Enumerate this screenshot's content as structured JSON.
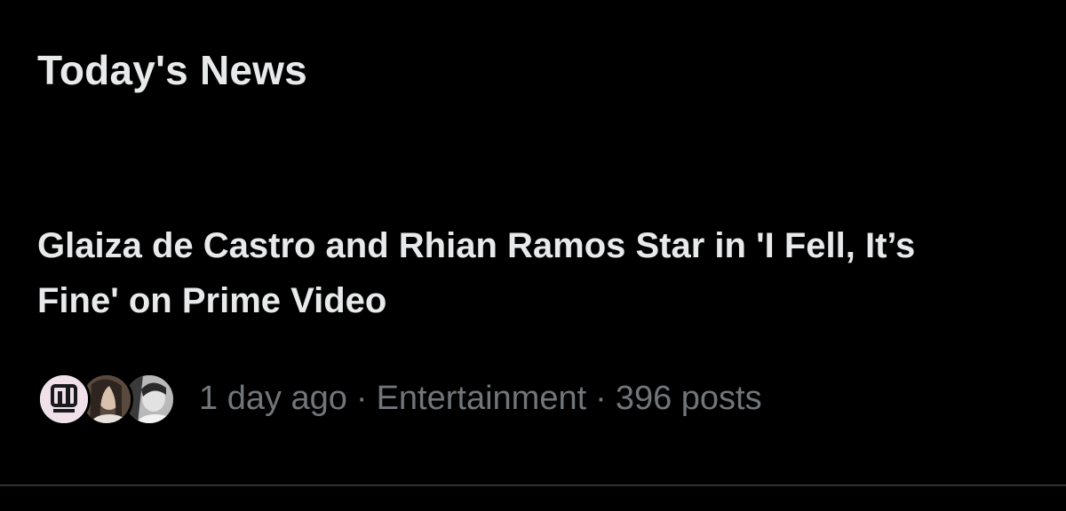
{
  "section": {
    "title": "Today's News"
  },
  "news_item": {
    "headline": "Glaiza de Castro and Rhian Ramos Star in 'I Fell, It’s Fine' on Prime Video",
    "time_ago": "1 day ago",
    "separator": "·",
    "category": "Entertainment",
    "post_count": "396 posts",
    "avatars": [
      "publisher-logo-avatar",
      "user-avatar",
      "user-avatar"
    ]
  },
  "colors": {
    "background": "#000000",
    "primary_text": "#e7e9ea",
    "secondary_text": "#71767b",
    "divider": "#2f3336"
  }
}
